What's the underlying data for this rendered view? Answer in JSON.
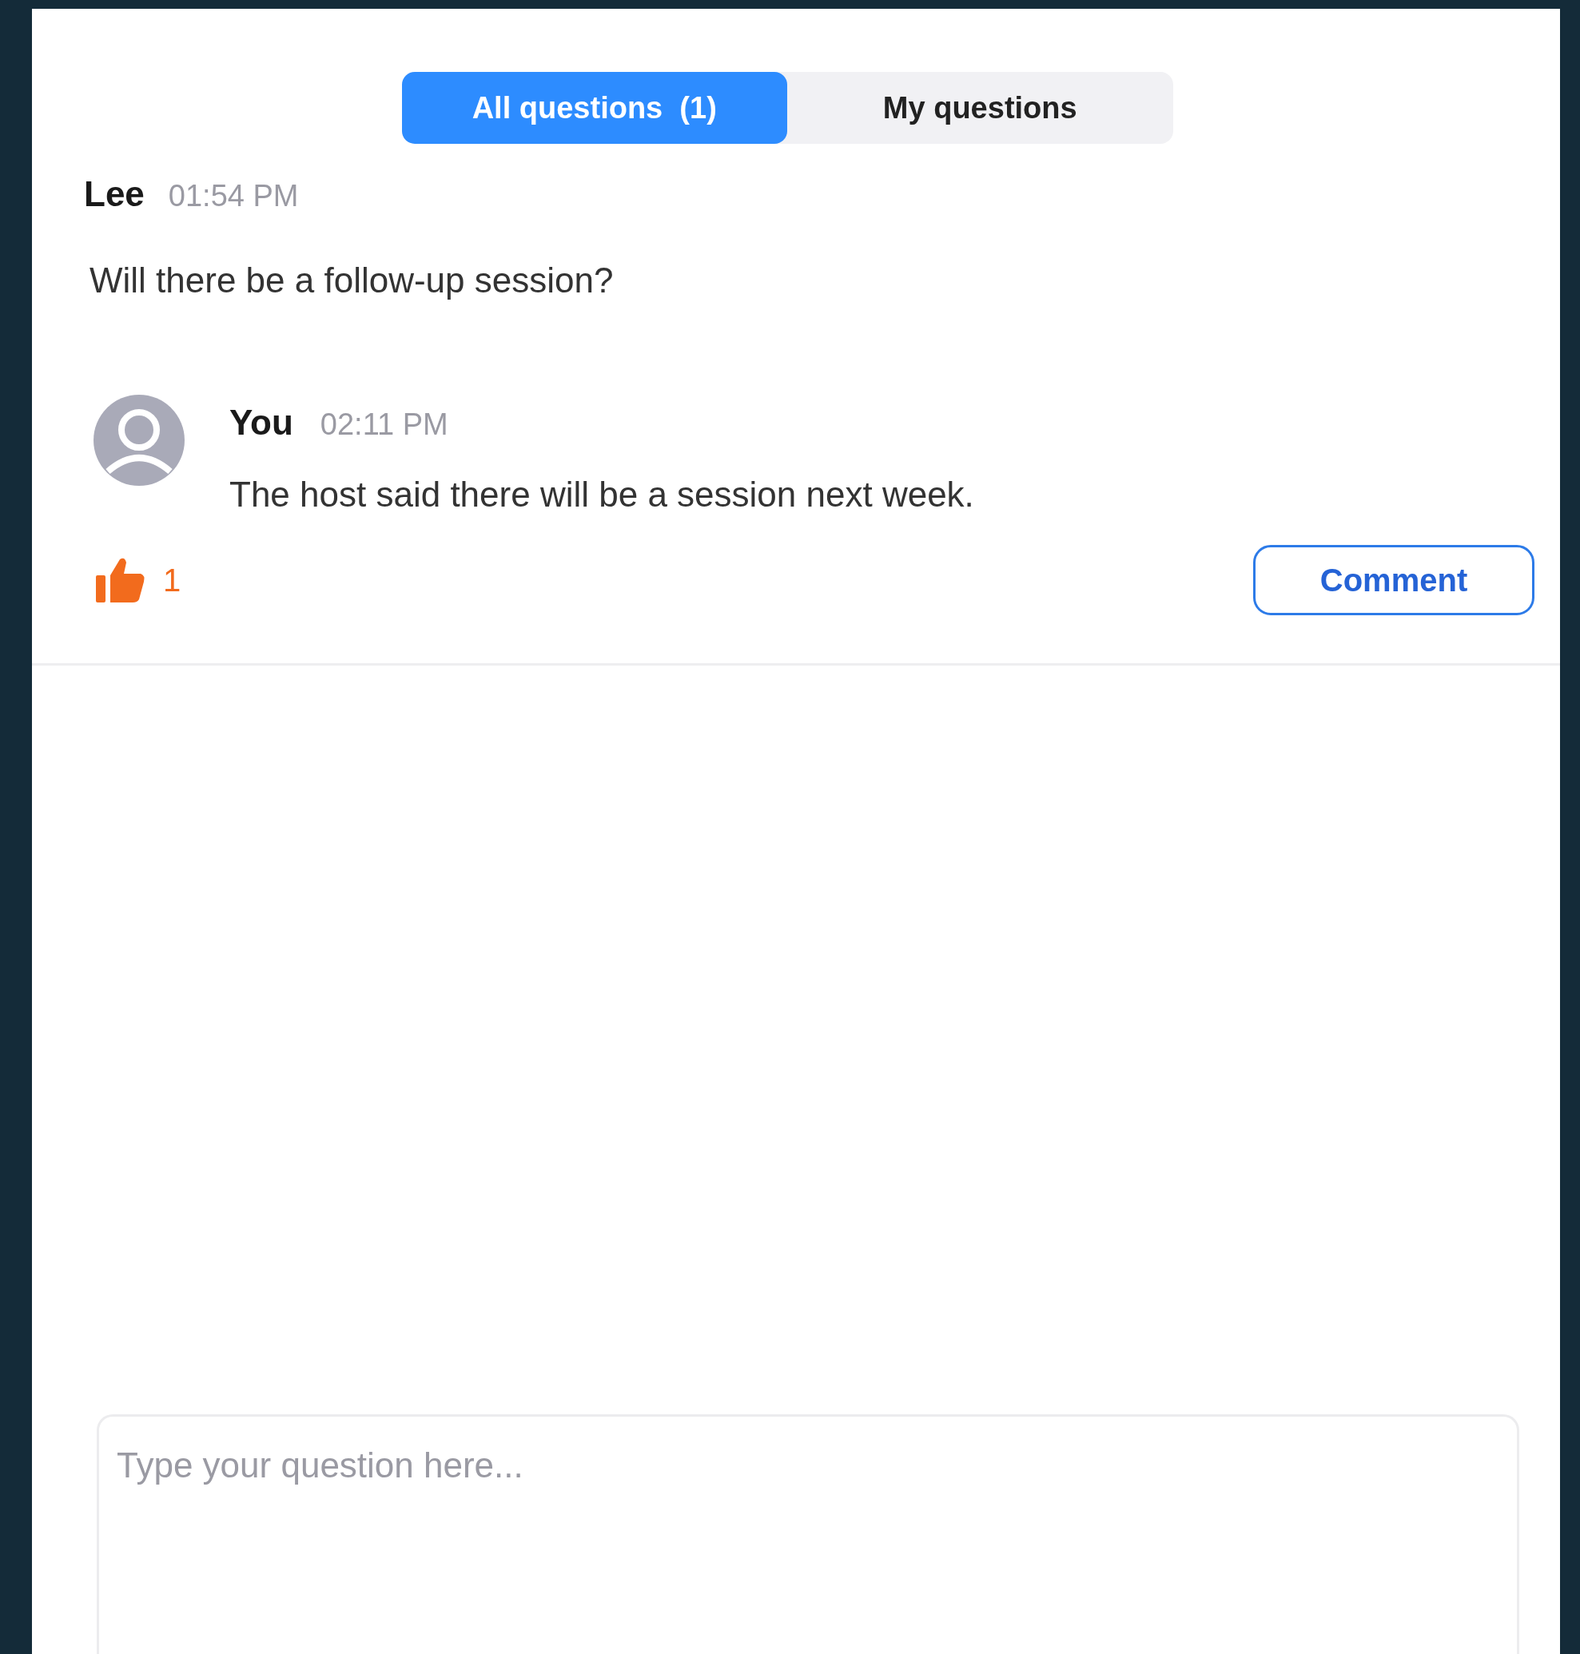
{
  "tabs": [
    {
      "label": "All questions  (1)",
      "selected": true
    },
    {
      "label": "My questions",
      "selected": false
    }
  ],
  "question": {
    "author": "Lee",
    "time": "01:54 PM",
    "text": "Will there be a follow-up session?"
  },
  "answers": [
    {
      "author": "You",
      "time": "02:11 PM",
      "text": "The host said there will be a session next week."
    }
  ],
  "likes": {
    "count": "1",
    "liked": true
  },
  "comment_button": "Comment",
  "input": {
    "placeholder": "Type your question here..."
  }
}
